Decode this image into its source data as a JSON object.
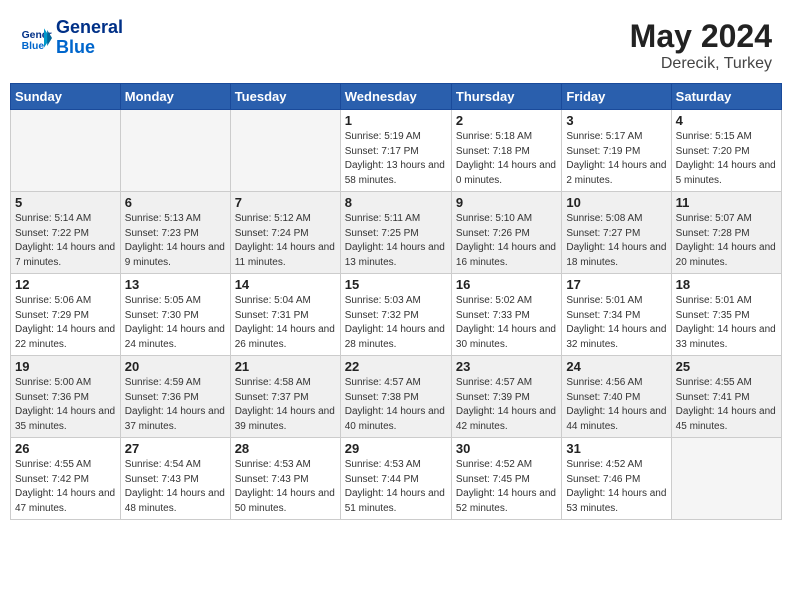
{
  "header": {
    "logo_line1": "General",
    "logo_line2": "Blue",
    "month_year": "May 2024",
    "location": "Derecik, Turkey"
  },
  "weekdays": [
    "Sunday",
    "Monday",
    "Tuesday",
    "Wednesday",
    "Thursday",
    "Friday",
    "Saturday"
  ],
  "weeks": [
    [
      {
        "day": "",
        "info": ""
      },
      {
        "day": "",
        "info": ""
      },
      {
        "day": "",
        "info": ""
      },
      {
        "day": "1",
        "info": "Sunrise: 5:19 AM\nSunset: 7:17 PM\nDaylight: 13 hours and 58 minutes."
      },
      {
        "day": "2",
        "info": "Sunrise: 5:18 AM\nSunset: 7:18 PM\nDaylight: 14 hours and 0 minutes."
      },
      {
        "day": "3",
        "info": "Sunrise: 5:17 AM\nSunset: 7:19 PM\nDaylight: 14 hours and 2 minutes."
      },
      {
        "day": "4",
        "info": "Sunrise: 5:15 AM\nSunset: 7:20 PM\nDaylight: 14 hours and 5 minutes."
      }
    ],
    [
      {
        "day": "5",
        "info": "Sunrise: 5:14 AM\nSunset: 7:22 PM\nDaylight: 14 hours and 7 minutes."
      },
      {
        "day": "6",
        "info": "Sunrise: 5:13 AM\nSunset: 7:23 PM\nDaylight: 14 hours and 9 minutes."
      },
      {
        "day": "7",
        "info": "Sunrise: 5:12 AM\nSunset: 7:24 PM\nDaylight: 14 hours and 11 minutes."
      },
      {
        "day": "8",
        "info": "Sunrise: 5:11 AM\nSunset: 7:25 PM\nDaylight: 14 hours and 13 minutes."
      },
      {
        "day": "9",
        "info": "Sunrise: 5:10 AM\nSunset: 7:26 PM\nDaylight: 14 hours and 16 minutes."
      },
      {
        "day": "10",
        "info": "Sunrise: 5:08 AM\nSunset: 7:27 PM\nDaylight: 14 hours and 18 minutes."
      },
      {
        "day": "11",
        "info": "Sunrise: 5:07 AM\nSunset: 7:28 PM\nDaylight: 14 hours and 20 minutes."
      }
    ],
    [
      {
        "day": "12",
        "info": "Sunrise: 5:06 AM\nSunset: 7:29 PM\nDaylight: 14 hours and 22 minutes."
      },
      {
        "day": "13",
        "info": "Sunrise: 5:05 AM\nSunset: 7:30 PM\nDaylight: 14 hours and 24 minutes."
      },
      {
        "day": "14",
        "info": "Sunrise: 5:04 AM\nSunset: 7:31 PM\nDaylight: 14 hours and 26 minutes."
      },
      {
        "day": "15",
        "info": "Sunrise: 5:03 AM\nSunset: 7:32 PM\nDaylight: 14 hours and 28 minutes."
      },
      {
        "day": "16",
        "info": "Sunrise: 5:02 AM\nSunset: 7:33 PM\nDaylight: 14 hours and 30 minutes."
      },
      {
        "day": "17",
        "info": "Sunrise: 5:01 AM\nSunset: 7:34 PM\nDaylight: 14 hours and 32 minutes."
      },
      {
        "day": "18",
        "info": "Sunrise: 5:01 AM\nSunset: 7:35 PM\nDaylight: 14 hours and 33 minutes."
      }
    ],
    [
      {
        "day": "19",
        "info": "Sunrise: 5:00 AM\nSunset: 7:36 PM\nDaylight: 14 hours and 35 minutes."
      },
      {
        "day": "20",
        "info": "Sunrise: 4:59 AM\nSunset: 7:36 PM\nDaylight: 14 hours and 37 minutes."
      },
      {
        "day": "21",
        "info": "Sunrise: 4:58 AM\nSunset: 7:37 PM\nDaylight: 14 hours and 39 minutes."
      },
      {
        "day": "22",
        "info": "Sunrise: 4:57 AM\nSunset: 7:38 PM\nDaylight: 14 hours and 40 minutes."
      },
      {
        "day": "23",
        "info": "Sunrise: 4:57 AM\nSunset: 7:39 PM\nDaylight: 14 hours and 42 minutes."
      },
      {
        "day": "24",
        "info": "Sunrise: 4:56 AM\nSunset: 7:40 PM\nDaylight: 14 hours and 44 minutes."
      },
      {
        "day": "25",
        "info": "Sunrise: 4:55 AM\nSunset: 7:41 PM\nDaylight: 14 hours and 45 minutes."
      }
    ],
    [
      {
        "day": "26",
        "info": "Sunrise: 4:55 AM\nSunset: 7:42 PM\nDaylight: 14 hours and 47 minutes."
      },
      {
        "day": "27",
        "info": "Sunrise: 4:54 AM\nSunset: 7:43 PM\nDaylight: 14 hours and 48 minutes."
      },
      {
        "day": "28",
        "info": "Sunrise: 4:53 AM\nSunset: 7:43 PM\nDaylight: 14 hours and 50 minutes."
      },
      {
        "day": "29",
        "info": "Sunrise: 4:53 AM\nSunset: 7:44 PM\nDaylight: 14 hours and 51 minutes."
      },
      {
        "day": "30",
        "info": "Sunrise: 4:52 AM\nSunset: 7:45 PM\nDaylight: 14 hours and 52 minutes."
      },
      {
        "day": "31",
        "info": "Sunrise: 4:52 AM\nSunset: 7:46 PM\nDaylight: 14 hours and 53 minutes."
      },
      {
        "day": "",
        "info": ""
      }
    ]
  ]
}
